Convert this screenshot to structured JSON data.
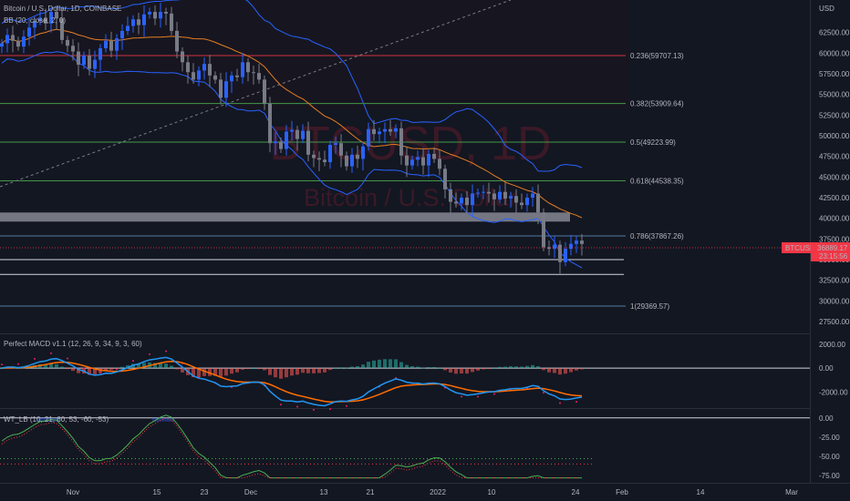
{
  "header": {
    "symbol": "Bitcoin / U.S. Dollar, 1D, COINBASE",
    "bb": "BB (20, close, 2, 0)",
    "macd": "Perfect MACD v1.1 (12, 26, 9, 34, 9, 3, 60)",
    "wt": "WT_LB (10, 21, 60, 53, -60, -53)"
  },
  "watermark": {
    "ticker": "BTCUSD, 1D",
    "name": "Bitcoin / U.S. Dollar"
  },
  "price_axis": {
    "currency": "USD",
    "ticks": [
      "62500.00",
      "60000.00",
      "57500.00",
      "55000.00",
      "52500.00",
      "50000.00",
      "47500.00",
      "45000.00",
      "42500.00",
      "40000.00",
      "37500.00",
      "35000.00",
      "32500.00",
      "30000.00",
      "27500.00"
    ],
    "badge_label": "BTCUSD",
    "badge_price": "36889.17",
    "badge_timer": "23:15:56"
  },
  "macd_axis": {
    "ticks": [
      "2000.00",
      "0.00",
      "-2000.00"
    ]
  },
  "wt_axis": {
    "ticks": [
      "0.00",
      "-25.00",
      "-50.00",
      "-75.00"
    ]
  },
  "time_axis": {
    "ticks": [
      "Nov",
      "15",
      "23",
      "Dec",
      "13",
      "21",
      "2022",
      "10",
      "24",
      "Feb",
      "14",
      "Mar"
    ]
  },
  "colors": {
    "background": "#131722",
    "up": "#2962ff",
    "down": "#787b86",
    "bb_band": "#2962ff",
    "bb_basis": "#e67e22",
    "fib_red": "#f23645",
    "fib_green": "#4caf50",
    "badge": "#f23645"
  },
  "chart_data": [
    {
      "type": "candlestick",
      "title": "Bitcoin / U.S. Dollar, 1D, COINBASE",
      "ylim": [
        26500,
        66000
      ],
      "fib_levels": [
        {
          "label": "0.236(59707.13)",
          "ratio": "0.236",
          "value": 59707.13
        },
        {
          "label": "0.382(53909.64)",
          "ratio": "0.382",
          "value": 53909.64
        },
        {
          "label": "0.5(49223.99)",
          "ratio": "0.5",
          "value": 49223.99
        },
        {
          "label": "0.618(44538.35)",
          "ratio": "0.618",
          "value": 44538.35
        },
        {
          "label": "0.786(37867.26)",
          "ratio": "0.786",
          "value": 37867.26
        },
        {
          "label": "1(29369.57)",
          "ratio": "1",
          "value": 29369.57
        }
      ],
      "support_levels": [
        35000,
        33200
      ],
      "resistance_zone": [
        39600,
        40700
      ],
      "current_price": 36889.17,
      "closes": [
        61200,
        62200,
        61500,
        60800,
        62000,
        63100,
        63900,
        64300,
        63600,
        65000,
        64200,
        61600,
        60900,
        60200,
        58600,
        59700,
        58100,
        59200,
        60600,
        61500,
        60300,
        61800,
        62700,
        63300,
        64100,
        63400,
        64700,
        65000,
        64200,
        65000,
        64800,
        62700,
        60200,
        58900,
        57700,
        56800,
        57900,
        58700,
        57300,
        56800,
        54600,
        56600,
        57300,
        57100,
        58900,
        57700,
        57600,
        56800,
        53900,
        49100,
        49300,
        48400,
        50500,
        50700,
        49600,
        50600,
        47700,
        47300,
        47100,
        46800,
        48900,
        49100,
        47600,
        46300,
        47700,
        47200,
        48700,
        50800,
        50200,
        50500,
        50800,
        50500,
        50900,
        47600,
        46400,
        47100,
        47400,
        46400,
        47800,
        47200,
        46000,
        43500,
        42000,
        41800,
        42500,
        41600,
        43000,
        43100,
        43200,
        43000,
        42300,
        43200,
        42400,
        42700,
        41900,
        41600,
        42500,
        43000,
        40700,
        36500,
        36300,
        36800,
        34700,
        36300,
        36900,
        37300,
        36889
      ]
    },
    {
      "type": "macd",
      "title": "Perfect MACD v1.1 (12, 26, 9, 34, 9, 3, 60)",
      "ylim": [
        -3200,
        2600
      ]
    },
    {
      "type": "oscillator",
      "title": "WT_LB (10, 21, 60, 53, -60, -53)",
      "ylim": [
        -82,
        8
      ]
    }
  ]
}
